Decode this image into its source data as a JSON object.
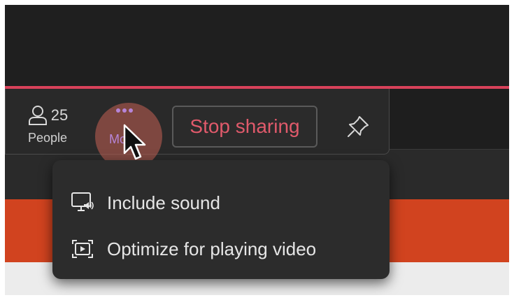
{
  "toolbar": {
    "people": {
      "count": "25",
      "label": "People"
    },
    "more": {
      "label": "More"
    },
    "stop_sharing_label": "Stop sharing"
  },
  "menu": {
    "items": [
      {
        "label": "Include sound",
        "icon": "monitor-sound-icon"
      },
      {
        "label": "Optimize for playing video",
        "icon": "video-frame-icon"
      }
    ]
  },
  "colors": {
    "share_border": "#d8425a",
    "stop_text": "#e05a6b",
    "more_accent": "#b685d8",
    "slide_orange": "#d1431f"
  }
}
